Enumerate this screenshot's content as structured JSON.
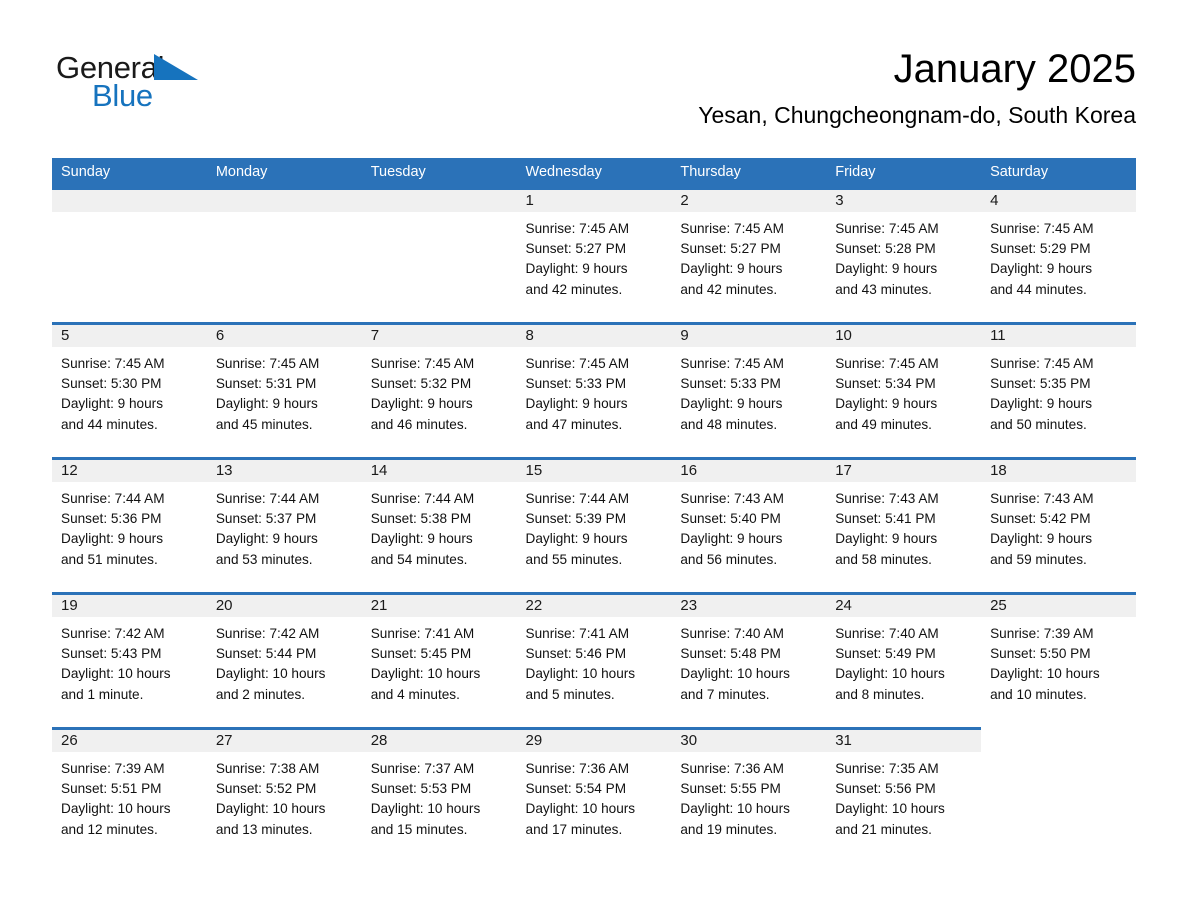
{
  "brand": {
    "name_part1": "General",
    "name_part2": "Blue",
    "accent_color": "#1673be"
  },
  "header": {
    "title": "January 2025",
    "subtitle": "Yesan, Chungcheongnam-do, South Korea"
  },
  "theme": {
    "header_bg": "#2b72b8",
    "daynum_band": "#f0f0f0",
    "text": "#111111"
  },
  "weekdays": [
    "Sunday",
    "Monday",
    "Tuesday",
    "Wednesday",
    "Thursday",
    "Friday",
    "Saturday"
  ],
  "weeks": [
    [
      {
        "day": "",
        "blank": true
      },
      {
        "day": "",
        "blank": true
      },
      {
        "day": "",
        "blank": true
      },
      {
        "day": "1",
        "sunrise": "Sunrise: 7:45 AM",
        "sunset": "Sunset: 5:27 PM",
        "daylight_line1": "Daylight: 9 hours",
        "daylight_line2": "and 42 minutes."
      },
      {
        "day": "2",
        "sunrise": "Sunrise: 7:45 AM",
        "sunset": "Sunset: 5:27 PM",
        "daylight_line1": "Daylight: 9 hours",
        "daylight_line2": "and 42 minutes."
      },
      {
        "day": "3",
        "sunrise": "Sunrise: 7:45 AM",
        "sunset": "Sunset: 5:28 PM",
        "daylight_line1": "Daylight: 9 hours",
        "daylight_line2": "and 43 minutes."
      },
      {
        "day": "4",
        "sunrise": "Sunrise: 7:45 AM",
        "sunset": "Sunset: 5:29 PM",
        "daylight_line1": "Daylight: 9 hours",
        "daylight_line2": "and 44 minutes."
      }
    ],
    [
      {
        "day": "5",
        "sunrise": "Sunrise: 7:45 AM",
        "sunset": "Sunset: 5:30 PM",
        "daylight_line1": "Daylight: 9 hours",
        "daylight_line2": "and 44 minutes."
      },
      {
        "day": "6",
        "sunrise": "Sunrise: 7:45 AM",
        "sunset": "Sunset: 5:31 PM",
        "daylight_line1": "Daylight: 9 hours",
        "daylight_line2": "and 45 minutes."
      },
      {
        "day": "7",
        "sunrise": "Sunrise: 7:45 AM",
        "sunset": "Sunset: 5:32 PM",
        "daylight_line1": "Daylight: 9 hours",
        "daylight_line2": "and 46 minutes."
      },
      {
        "day": "8",
        "sunrise": "Sunrise: 7:45 AM",
        "sunset": "Sunset: 5:33 PM",
        "daylight_line1": "Daylight: 9 hours",
        "daylight_line2": "and 47 minutes."
      },
      {
        "day": "9",
        "sunrise": "Sunrise: 7:45 AM",
        "sunset": "Sunset: 5:33 PM",
        "daylight_line1": "Daylight: 9 hours",
        "daylight_line2": "and 48 minutes."
      },
      {
        "day": "10",
        "sunrise": "Sunrise: 7:45 AM",
        "sunset": "Sunset: 5:34 PM",
        "daylight_line1": "Daylight: 9 hours",
        "daylight_line2": "and 49 minutes."
      },
      {
        "day": "11",
        "sunrise": "Sunrise: 7:45 AM",
        "sunset": "Sunset: 5:35 PM",
        "daylight_line1": "Daylight: 9 hours",
        "daylight_line2": "and 50 minutes."
      }
    ],
    [
      {
        "day": "12",
        "sunrise": "Sunrise: 7:44 AM",
        "sunset": "Sunset: 5:36 PM",
        "daylight_line1": "Daylight: 9 hours",
        "daylight_line2": "and 51 minutes."
      },
      {
        "day": "13",
        "sunrise": "Sunrise: 7:44 AM",
        "sunset": "Sunset: 5:37 PM",
        "daylight_line1": "Daylight: 9 hours",
        "daylight_line2": "and 53 minutes."
      },
      {
        "day": "14",
        "sunrise": "Sunrise: 7:44 AM",
        "sunset": "Sunset: 5:38 PM",
        "daylight_line1": "Daylight: 9 hours",
        "daylight_line2": "and 54 minutes."
      },
      {
        "day": "15",
        "sunrise": "Sunrise: 7:44 AM",
        "sunset": "Sunset: 5:39 PM",
        "daylight_line1": "Daylight: 9 hours",
        "daylight_line2": "and 55 minutes."
      },
      {
        "day": "16",
        "sunrise": "Sunrise: 7:43 AM",
        "sunset": "Sunset: 5:40 PM",
        "daylight_line1": "Daylight: 9 hours",
        "daylight_line2": "and 56 minutes."
      },
      {
        "day": "17",
        "sunrise": "Sunrise: 7:43 AM",
        "sunset": "Sunset: 5:41 PM",
        "daylight_line1": "Daylight: 9 hours",
        "daylight_line2": "and 58 minutes."
      },
      {
        "day": "18",
        "sunrise": "Sunrise: 7:43 AM",
        "sunset": "Sunset: 5:42 PM",
        "daylight_line1": "Daylight: 9 hours",
        "daylight_line2": "and 59 minutes."
      }
    ],
    [
      {
        "day": "19",
        "sunrise": "Sunrise: 7:42 AM",
        "sunset": "Sunset: 5:43 PM",
        "daylight_line1": "Daylight: 10 hours",
        "daylight_line2": "and 1 minute."
      },
      {
        "day": "20",
        "sunrise": "Sunrise: 7:42 AM",
        "sunset": "Sunset: 5:44 PM",
        "daylight_line1": "Daylight: 10 hours",
        "daylight_line2": "and 2 minutes."
      },
      {
        "day": "21",
        "sunrise": "Sunrise: 7:41 AM",
        "sunset": "Sunset: 5:45 PM",
        "daylight_line1": "Daylight: 10 hours",
        "daylight_line2": "and 4 minutes."
      },
      {
        "day": "22",
        "sunrise": "Sunrise: 7:41 AM",
        "sunset": "Sunset: 5:46 PM",
        "daylight_line1": "Daylight: 10 hours",
        "daylight_line2": "and 5 minutes."
      },
      {
        "day": "23",
        "sunrise": "Sunrise: 7:40 AM",
        "sunset": "Sunset: 5:48 PM",
        "daylight_line1": "Daylight: 10 hours",
        "daylight_line2": "and 7 minutes."
      },
      {
        "day": "24",
        "sunrise": "Sunrise: 7:40 AM",
        "sunset": "Sunset: 5:49 PM",
        "daylight_line1": "Daylight: 10 hours",
        "daylight_line2": "and 8 minutes."
      },
      {
        "day": "25",
        "sunrise": "Sunrise: 7:39 AM",
        "sunset": "Sunset: 5:50 PM",
        "daylight_line1": "Daylight: 10 hours",
        "daylight_line2": "and 10 minutes."
      }
    ],
    [
      {
        "day": "26",
        "sunrise": "Sunrise: 7:39 AM",
        "sunset": "Sunset: 5:51 PM",
        "daylight_line1": "Daylight: 10 hours",
        "daylight_line2": "and 12 minutes."
      },
      {
        "day": "27",
        "sunrise": "Sunrise: 7:38 AM",
        "sunset": "Sunset: 5:52 PM",
        "daylight_line1": "Daylight: 10 hours",
        "daylight_line2": "and 13 minutes."
      },
      {
        "day": "28",
        "sunrise": "Sunrise: 7:37 AM",
        "sunset": "Sunset: 5:53 PM",
        "daylight_line1": "Daylight: 10 hours",
        "daylight_line2": "and 15 minutes."
      },
      {
        "day": "29",
        "sunrise": "Sunrise: 7:36 AM",
        "sunset": "Sunset: 5:54 PM",
        "daylight_line1": "Daylight: 10 hours",
        "daylight_line2": "and 17 minutes."
      },
      {
        "day": "30",
        "sunrise": "Sunrise: 7:36 AM",
        "sunset": "Sunset: 5:55 PM",
        "daylight_line1": "Daylight: 10 hours",
        "daylight_line2": "and 19 minutes."
      },
      {
        "day": "31",
        "sunrise": "Sunrise: 7:35 AM",
        "sunset": "Sunset: 5:56 PM",
        "daylight_line1": "Daylight: 10 hours",
        "daylight_line2": "and 21 minutes."
      },
      {
        "day": "",
        "void": true
      }
    ]
  ]
}
